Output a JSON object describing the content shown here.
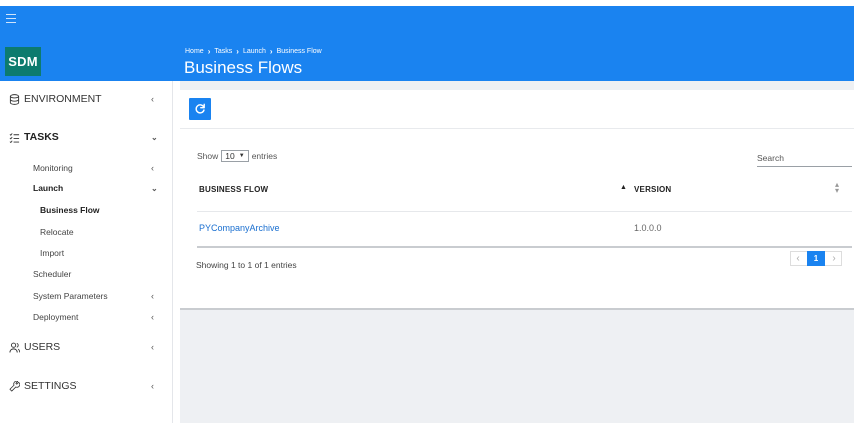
{
  "header": {
    "logo": "SDM",
    "breadcrumb": [
      "Home",
      "Tasks",
      "Launch",
      "Business Flow"
    ],
    "title": "Business Flows"
  },
  "sidebar": {
    "environment": "ENVIRONMENT",
    "tasks": "TASKS",
    "monitoring": "Monitoring",
    "launch": "Launch",
    "business_flow": "Business Flow",
    "relocate": "Relocate",
    "import": "Import",
    "scheduler": "Scheduler",
    "system_parameters": "System Parameters",
    "deployment": "Deployment",
    "users": "USERS",
    "settings": "SETTINGS"
  },
  "table": {
    "show_label": "Show",
    "entries_label": "entries",
    "page_size": "10",
    "search_label": "Search",
    "columns": [
      "BUSINESS FLOW",
      "VERSION"
    ],
    "rows": [
      {
        "name": "PYCompanyArchive",
        "version": "1.0.0.0"
      }
    ],
    "summary": "Showing 1 to 1 of 1 entries",
    "current_page": "1"
  },
  "colors": {
    "primary": "#1a83f0",
    "logo_bg": "#0d7b6e",
    "link": "#1a6fd0"
  }
}
